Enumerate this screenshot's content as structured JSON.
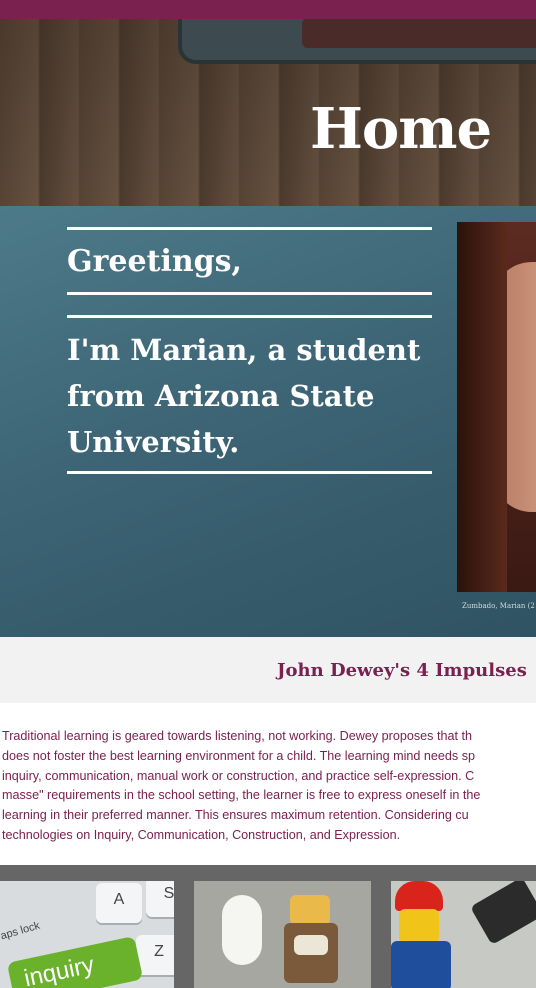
{
  "header": {
    "title": "Home"
  },
  "intro": {
    "greeting": "Greetings,",
    "bio": "I'm Marian, a student from Arizona State University.",
    "photo_credit": "Zumbado, Marian (2"
  },
  "section": {
    "title": "John Dewey's 4 Impulses",
    "paragraph_lines": [
      "Traditional learning is geared towards listening, not working. Dewey proposes that th",
      "does not foster the best learning environment for a child. The learning mind needs sp",
      "inquiry, communication, manual work or construction, and practice self-expression. C",
      "masse\" requirements in the school setting, the learner is free to express oneself in the",
      "learning in their preferred manner. This ensures maximum retention. Considering cu",
      "technologies on Inquiry,  Communication, Construction, and Expression."
    ]
  },
  "gallery": {
    "inquiry_key_label": "inquiry",
    "caps_lock_label": "aps lock",
    "key_letters": [
      "A",
      "Z",
      "S"
    ]
  },
  "colors": {
    "accent": "#7a2150",
    "intro_bg": "#3d6575",
    "band_bg": "#f2f2f2"
  }
}
